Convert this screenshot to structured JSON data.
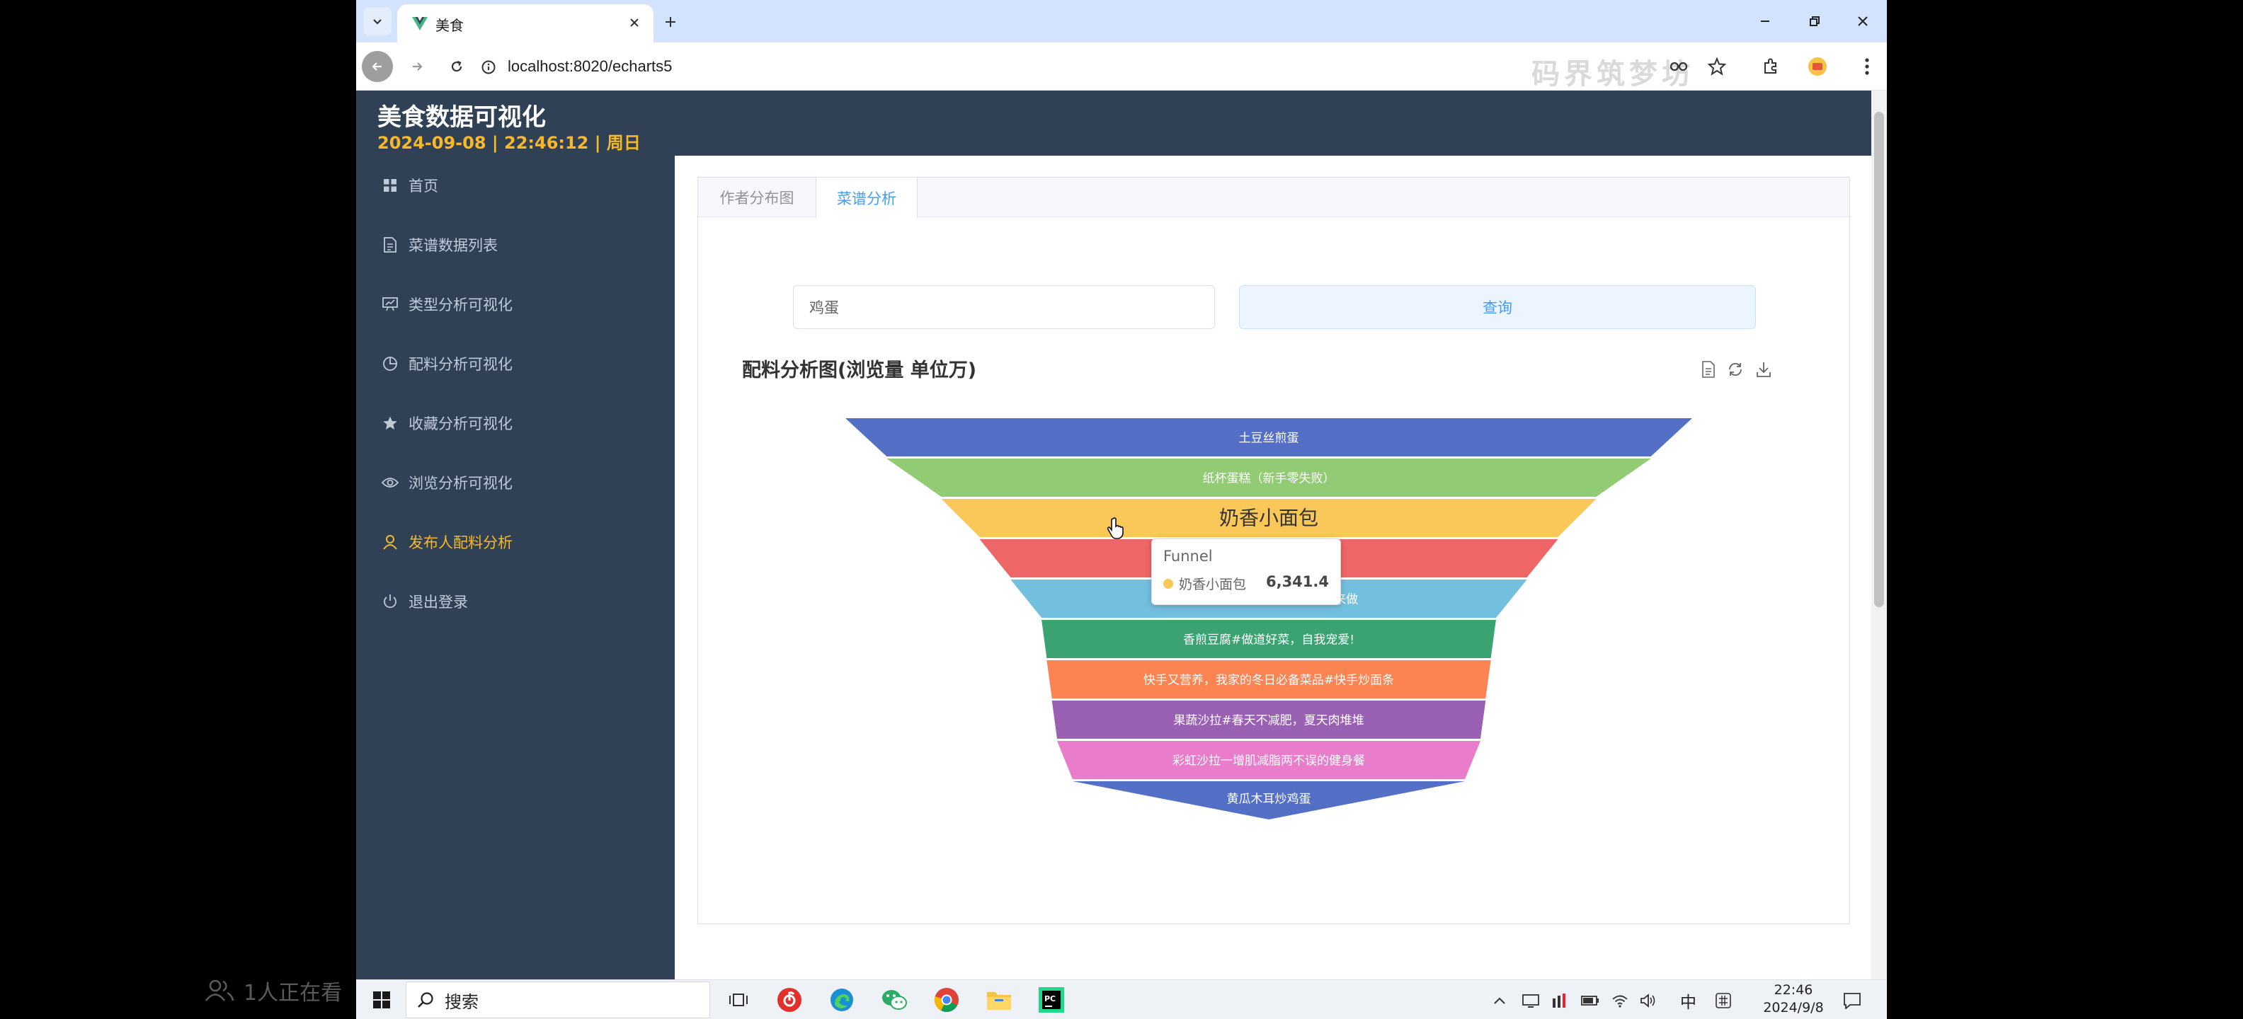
{
  "browser": {
    "tab_title": "美食",
    "url": "localhost:8020/echarts5",
    "watermark": "码界筑梦坊"
  },
  "app": {
    "title": "美食数据可视化",
    "datetime": "2024-09-08 | 22:46:12 | 周日"
  },
  "sidebar": {
    "items": [
      {
        "label": "首页",
        "icon": "grid-icon",
        "active": false
      },
      {
        "label": "菜谱数据列表",
        "icon": "document-icon",
        "active": false
      },
      {
        "label": "类型分析可视化",
        "icon": "chart-board-icon",
        "active": false
      },
      {
        "label": "配料分析可视化",
        "icon": "pie-icon",
        "active": false
      },
      {
        "label": "收藏分析可视化",
        "icon": "star-icon",
        "active": false
      },
      {
        "label": "浏览分析可视化",
        "icon": "eye-icon",
        "active": false
      },
      {
        "label": "发布人配料分析",
        "icon": "user-icon",
        "active": true
      },
      {
        "label": "退出登录",
        "icon": "power-icon",
        "active": false
      }
    ]
  },
  "main": {
    "tabs": [
      {
        "label": "作者分布图",
        "active": false
      },
      {
        "label": "菜谱分析",
        "active": true
      }
    ],
    "search": {
      "value": "鸡蛋"
    },
    "query_label": "查询",
    "chart_title": "配料分析图(浏览量 单位万)"
  },
  "chart_data": {
    "type": "funnel",
    "title": "配料分析图(浏览量 单位万)",
    "series_name": "Funnel",
    "categories": [
      "土豆丝煎蛋",
      "纸杯蛋糕（新手零失败）",
      "奶香小面包",
      "电饭煲版日式蛋包饭料理",
      "秘制酱汁鸡蛋饼#网红美食我来做",
      "香煎豆腐#做道好菜，自我宠爱!",
      "快手又营养，我家的冬日必备菜品#快手炒面条",
      "果蔬沙拉#春天不减肥，夏天肉堆堆",
      "彩虹沙拉一增肌减脂两不误的健身餐",
      "黄瓜木耳炒鸡蛋"
    ],
    "values": [
      8200,
      7400,
      6341.4,
      5600,
      5000,
      4400,
      4300,
      4200,
      4100,
      3800
    ],
    "colors": [
      "#5470c6",
      "#91cc75",
      "#fac858",
      "#ee6666",
      "#73c0de",
      "#3ba272",
      "#fc8452",
      "#9a60b4",
      "#ea7ccc",
      "#5470c6"
    ],
    "highlighted_index": 2,
    "tooltip": {
      "series": "Funnel",
      "name": "奶香小面包",
      "value": "6,341.4"
    }
  },
  "taskbar": {
    "search_placeholder": "搜索",
    "ime": "中",
    "time": "22:46",
    "date": "2024/9/8"
  },
  "overlay": {
    "viewers": "1人正在看"
  }
}
